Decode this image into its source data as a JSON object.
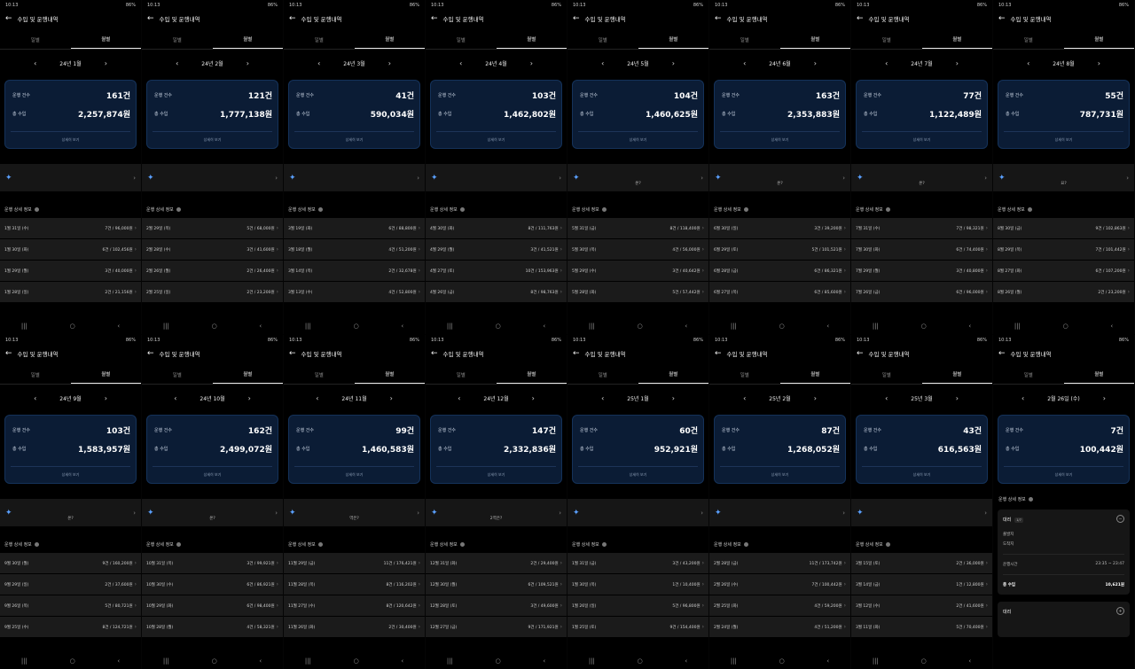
{
  "common": {
    "time": "10:13",
    "battery": "86%",
    "title": "수입 및 운행내역",
    "tab_daily": "일별",
    "tab_monthly": "월별",
    "count_label": "운행 건수",
    "income_label": "총 수입",
    "more_label": "상세히 보기",
    "section_label": "운행 상세 정보"
  },
  "panels": [
    {
      "month": "24년 1월",
      "count": "161건",
      "income": "2,257,874원",
      "banner": "",
      "rows": [
        [
          "1월 31일 (수)",
          "7건 / 96,000원"
        ],
        [
          "1월 30일 (화)",
          "6건 / 102,456원"
        ],
        [
          "1월 29일 (월)",
          "3건 / 40,000원"
        ],
        [
          "1월 28일 (일)",
          "2건 / 21,156원"
        ]
      ]
    },
    {
      "month": "24년 2월",
      "count": "121건",
      "income": "1,777,138원",
      "banner": "",
      "rows": [
        [
          "2월 29일 (목)",
          "5건 / 68,000원"
        ],
        [
          "2월 28일 (수)",
          "3건 / 41,600원"
        ],
        [
          "2월 26일 (월)",
          "2건 / 26,400원"
        ],
        [
          "2월 25일 (일)",
          "2건 / 23,200원"
        ]
      ]
    },
    {
      "month": "24년 3월",
      "count": "41건",
      "income": "590,034원",
      "banner": "",
      "rows": [
        [
          "3월 19일 (화)",
          "6건 / 88,800원"
        ],
        [
          "3월 18일 (월)",
          "4건 / 51,200원"
        ],
        [
          "3월 14일 (목)",
          "2건 / 32,678원"
        ],
        [
          "3월 13일 (수)",
          "4건 / 52,800원"
        ]
      ]
    },
    {
      "month": "24년 4월",
      "count": "103건",
      "income": "1,462,802원",
      "banner": "",
      "rows": [
        [
          "4월 30일 (화)",
          "8건 / 111,763원"
        ],
        [
          "4월 29일 (월)",
          "3건 / 41,521원"
        ],
        [
          "4월 27일 (토)",
          "10건 / 153,963원"
        ],
        [
          "4월 26일 (금)",
          "8건 / 98,763원"
        ]
      ]
    },
    {
      "month": "24년 5월",
      "count": "104건",
      "income": "1,460,625원",
      "banner": "온?",
      "rows": [
        [
          "5월 31일 (금)",
          "8건 / 118,400원"
        ],
        [
          "5월 30일 (목)",
          "4건 / 56,000원"
        ],
        [
          "5월 29일 (수)",
          "3건 / 40,642원"
        ],
        [
          "5월 28일 (화)",
          "5건 / 57,442원"
        ]
      ]
    },
    {
      "month": "24년 6월",
      "count": "163건",
      "income": "2,353,883원",
      "banner": "온?",
      "rows": [
        [
          "6월 30일 (일)",
          "3건 / 39,200원"
        ],
        [
          "6월 29일 (토)",
          "5건 / 101,521원"
        ],
        [
          "6월 28일 (금)",
          "6건 / 86,321원"
        ],
        [
          "6월 27일 (목)",
          "6건 / 85,600원"
        ]
      ]
    },
    {
      "month": "24년 7월",
      "count": "77건",
      "income": "1,122,489원",
      "banner": "온?",
      "rows": [
        [
          "7월 31일 (수)",
          "7건 / 98,321원"
        ],
        [
          "7월 30일 (화)",
          "6건 / 74,400원"
        ],
        [
          "7월 29일 (월)",
          "3건 / 40,800원"
        ],
        [
          "7월 26일 (금)",
          "6건 / 96,000원"
        ]
      ]
    },
    {
      "month": "24년 8월",
      "count": "55건",
      "income": "787,731원",
      "banner": "요?",
      "rows": [
        [
          "8월 30일 (금)",
          "9건 / 102,863원"
        ],
        [
          "8월 29일 (목)",
          "7건 / 101,442원"
        ],
        [
          "8월 27일 (화)",
          "6건 / 107,200원"
        ],
        [
          "8월 26일 (월)",
          "2건 / 23,200원"
        ]
      ]
    },
    {
      "month": "24년 9월",
      "count": "103건",
      "income": "1,583,957원",
      "banner": "온?",
      "rows": [
        [
          "9월 30일 (월)",
          "9건 / 160,200원"
        ],
        [
          "9월 29일 (일)",
          "2건 / 37,600원"
        ],
        [
          "9월 26일 (목)",
          "5건 / 80,721원"
        ],
        [
          "9월 25일 (수)",
          "8건 / 124,721원"
        ]
      ]
    },
    {
      "month": "24년 10월",
      "count": "162건",
      "income": "2,499,072원",
      "banner": "온?",
      "rows": [
        [
          "10월 31일 (목)",
          "3건 / 99,921원"
        ],
        [
          "10월 30일 (수)",
          "6건 / 86,921원"
        ],
        [
          "10월 29일 (화)",
          "6건 / 98,400원"
        ],
        [
          "10월 28일 (월)",
          "4건 / 58,321원"
        ]
      ]
    },
    {
      "month": "24년 11월",
      "count": "99건",
      "income": "1,460,583원",
      "banner": "역은?",
      "rows": [
        [
          "11월 29일 (금)",
          "11건 / 176,421원"
        ],
        [
          "11월 28일 (목)",
          "8건 / 116,202원"
        ],
        [
          "11월 27일 (수)",
          "8건 / 120,642원"
        ],
        [
          "11월 26일 (화)",
          "2건 / 30,400원"
        ]
      ]
    },
    {
      "month": "24년 12월",
      "count": "147건",
      "income": "2,332,836원",
      "banner": "2역은?",
      "rows": [
        [
          "12월 31일 (화)",
          "2건 / 29,400원"
        ],
        [
          "12월 30일 (월)",
          "6건 / 109,521원"
        ],
        [
          "12월 28일 (토)",
          "3건 / 49,600원"
        ],
        [
          "12월 27일 (금)",
          "9건 / 171,921원"
        ]
      ]
    },
    {
      "month": "25년 1월",
      "count": "60건",
      "income": "952,921원",
      "banner": "",
      "rows": [
        [
          "1월 31일 (금)",
          "3건 / 43,200원"
        ],
        [
          "1월 30일 (목)",
          "1건 / 10,400원"
        ],
        [
          "1월 26일 (일)",
          "5건 / 96,800원"
        ],
        [
          "1월 25일 (토)",
          "9건 / 154,400원"
        ]
      ]
    },
    {
      "month": "25년 2월",
      "count": "87건",
      "income": "1,268,052원",
      "banner": "",
      "rows": [
        [
          "2월 28일 (금)",
          "11건 / 173,742원"
        ],
        [
          "2월 26일 (수)",
          "7건 / 100,442원"
        ],
        [
          "2월 25일 (화)",
          "4건 / 59,200원"
        ],
        [
          "2월 24일 (월)",
          "4건 / 51,200원"
        ]
      ]
    },
    {
      "month": "25년 3월",
      "count": "43건",
      "income": "616,563원",
      "banner": "",
      "rows": [
        [
          "3월 15일 (토)",
          "2건 / 36,000원"
        ],
        [
          "3월 14일 (금)",
          "1건 / 12,800원"
        ],
        [
          "3월 12일 (수)",
          "2건 / 41,600원"
        ],
        [
          "3월 11일 (화)",
          "5건 / 70,400원"
        ]
      ]
    }
  ],
  "detail": {
    "month": "2월 26일 (수)",
    "count": "7건",
    "income": "100,442원",
    "section": "운행 상세 정보",
    "trip_title": "대리",
    "trip_badge": "1/7",
    "from": "출발지",
    "to": "도착지",
    "time_label": "운행시간",
    "time_value": "23:35 ~ 23:47",
    "income_label": "총 수입",
    "income_value": "10,621원",
    "trip2_title": "대리"
  }
}
